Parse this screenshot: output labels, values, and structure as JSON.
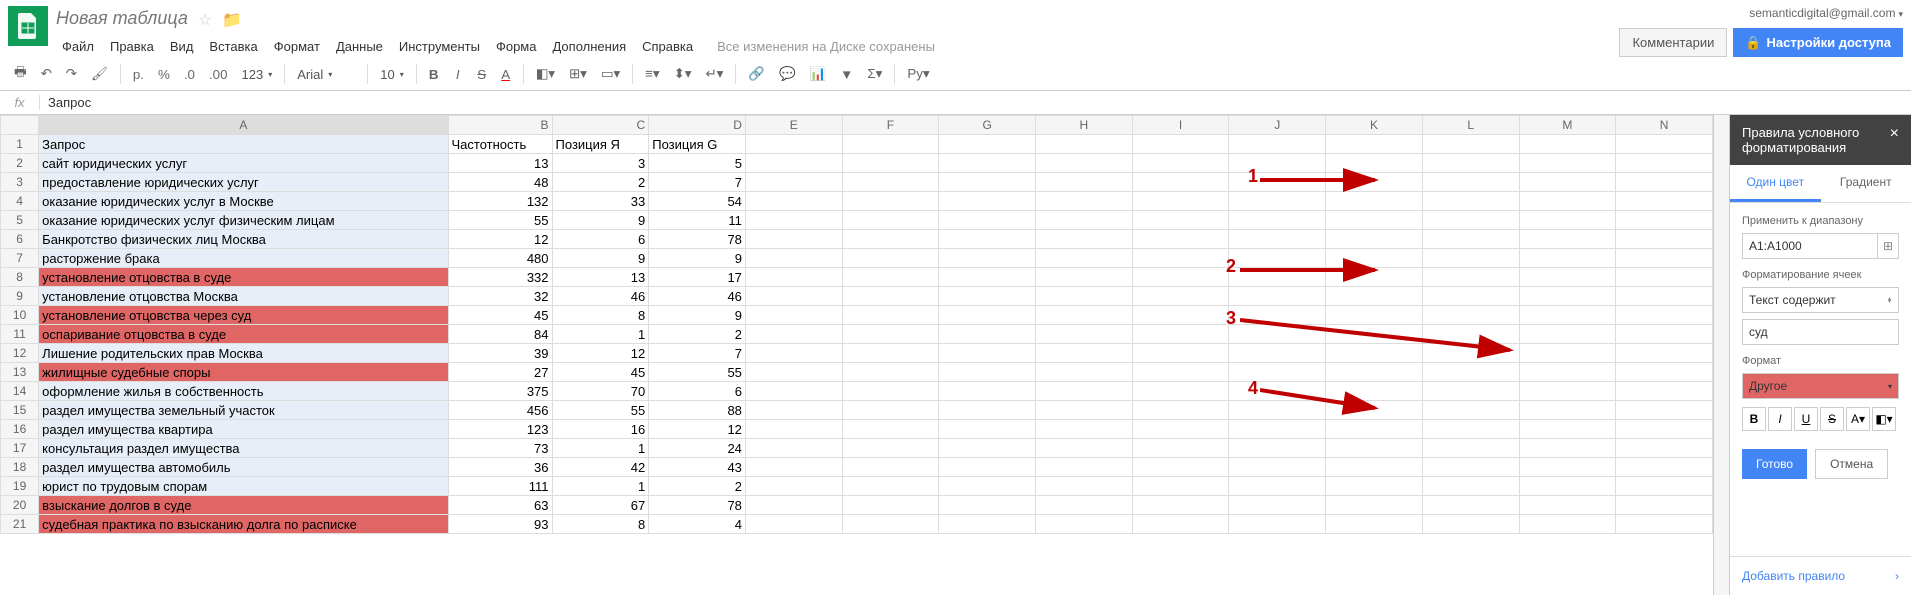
{
  "doc_title": "Новая таблица",
  "user_email": "semanticdigital@gmail.com",
  "buttons": {
    "comments": "Комментарии",
    "share": "Настройки доступа"
  },
  "menus": [
    "Файл",
    "Правка",
    "Вид",
    "Вставка",
    "Формат",
    "Данные",
    "Инструменты",
    "Форма",
    "Дополнения",
    "Справка"
  ],
  "save_status": "Все изменения на Диске сохранены",
  "toolbar": {
    "font": "Arial",
    "size": "10",
    "currency": "р.",
    "percent": "%",
    "dec0": ".0",
    "dec00": ".00",
    "num": "123"
  },
  "fx_value": "Запрос",
  "columns": [
    "A",
    "B",
    "C",
    "D",
    "E",
    "F",
    "G",
    "H",
    "I",
    "J",
    "K",
    "L",
    "M",
    "N"
  ],
  "headers": {
    "a": "Запрос",
    "b": "Частотность",
    "c": "Позиция Я",
    "d": "Позиция G"
  },
  "rows": [
    {
      "a": "сайт юридических услуг",
      "b": 13,
      "c": 3,
      "d": 5,
      "hl": false
    },
    {
      "a": "предоставление юридических услуг",
      "b": 48,
      "c": 2,
      "d": 7,
      "hl": false
    },
    {
      "a": "оказание юридических услуг в Москве",
      "b": 132,
      "c": 33,
      "d": 54,
      "hl": false
    },
    {
      "a": "оказание юридических услуг физическим лицам",
      "b": 55,
      "c": 9,
      "d": 11,
      "hl": false
    },
    {
      "a": "Банкротство физических лиц Москва",
      "b": 12,
      "c": 6,
      "d": 78,
      "hl": false
    },
    {
      "a": "расторжение брака",
      "b": 480,
      "c": 9,
      "d": 9,
      "hl": false
    },
    {
      "a": "установление отцовства в суде",
      "b": 332,
      "c": 13,
      "d": 17,
      "hl": true
    },
    {
      "a": "установление отцовства Москва",
      "b": 32,
      "c": 46,
      "d": 46,
      "hl": false
    },
    {
      "a": "установление отцовства через суд",
      "b": 45,
      "c": 8,
      "d": 9,
      "hl": true
    },
    {
      "a": "оспаривание отцовства в суде",
      "b": 84,
      "c": 1,
      "d": 2,
      "hl": true
    },
    {
      "a": "Лишение родительских прав Москва",
      "b": 39,
      "c": 12,
      "d": 7,
      "hl": false
    },
    {
      "a": "жилищные судебные споры",
      "b": 27,
      "c": 45,
      "d": 55,
      "hl": true
    },
    {
      "a": "оформление жилья в собственность",
      "b": 375,
      "c": 70,
      "d": 6,
      "hl": false
    },
    {
      "a": "раздел имущества земельный участок",
      "b": 456,
      "c": 55,
      "d": 88,
      "hl": false
    },
    {
      "a": "раздел имущества квартира",
      "b": 123,
      "c": 16,
      "d": 12,
      "hl": false
    },
    {
      "a": "консультация раздел имущества",
      "b": 73,
      "c": 1,
      "d": 24,
      "hl": false
    },
    {
      "a": "раздел имущества автомобиль",
      "b": 36,
      "c": 42,
      "d": 43,
      "hl": false
    },
    {
      "a": "юрист по трудовым спорам",
      "b": 111,
      "c": 1,
      "d": 2,
      "hl": false
    },
    {
      "a": "взыскание долгов в суде",
      "b": 63,
      "c": 67,
      "d": 78,
      "hl": true
    },
    {
      "a": "судебная практика по взысканию долга по расписке",
      "b": 93,
      "c": 8,
      "d": 4,
      "hl": true
    }
  ],
  "panel": {
    "title": "Правила условного форматирования",
    "tab1": "Один цвет",
    "tab2": "Градиент",
    "range_label": "Применить к диапазону",
    "range_value": "A1:A1000",
    "fmt_label": "Форматирование ячеек",
    "fmt_rule": "Текст содержит",
    "fmt_value": "суд",
    "format_label": "Формат",
    "format_preview": "Другое",
    "done": "Готово",
    "cancel": "Отмена",
    "add_rule": "Добавить правило"
  },
  "annotations": {
    "n1": "1",
    "n2": "2",
    "n3": "3",
    "n4": "4"
  }
}
